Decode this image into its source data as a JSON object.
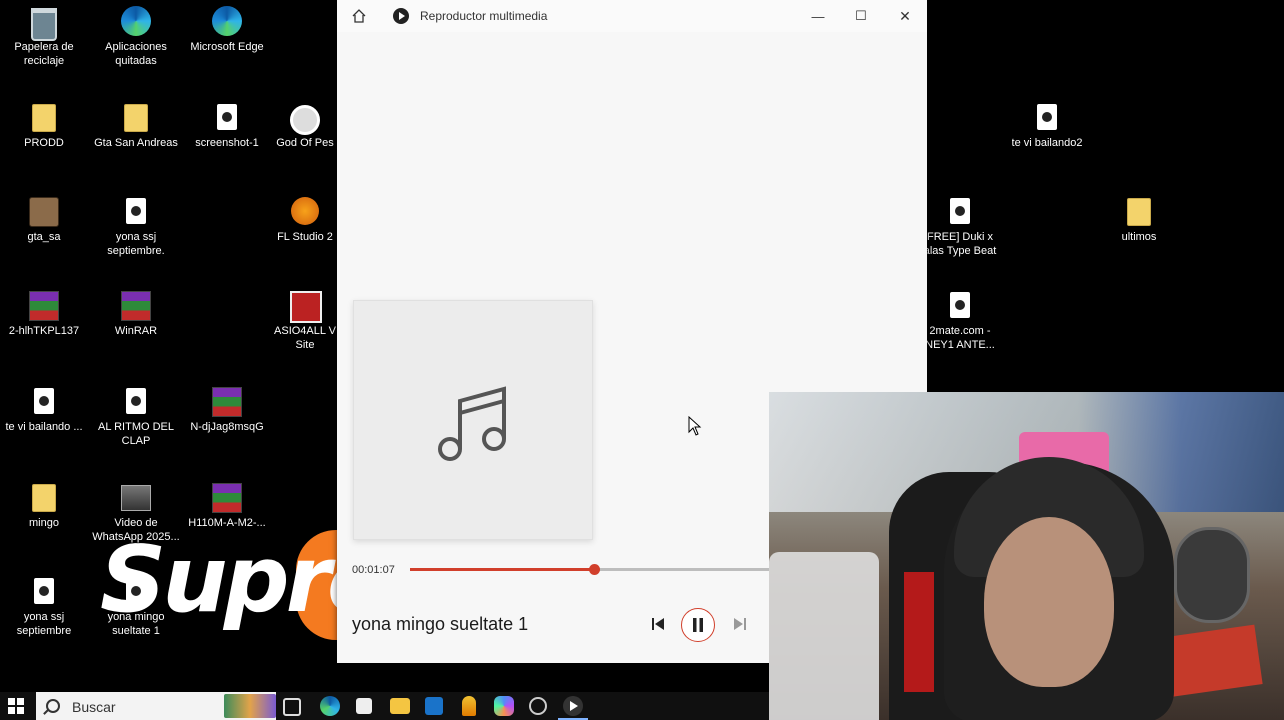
{
  "desktop": {
    "icons": [
      {
        "label": "Papelera de reciclaje",
        "icon": "recycle-bin-icon"
      },
      {
        "label": "Aplicaciones quitadas",
        "icon": "edge-icon"
      },
      {
        "label": "Microsoft Edge",
        "icon": "edge-icon"
      },
      {
        "label": "PRODD",
        "icon": "folder-icon"
      },
      {
        "label": "Gta San Andreas",
        "icon": "folder-icon"
      },
      {
        "label": "screenshot-1",
        "icon": "file-icon"
      },
      {
        "label": "God Of Pes",
        "icon": "disc-icon"
      },
      {
        "label": "te vi bailando2",
        "icon": "audio-file-icon"
      },
      {
        "label": "gta_sa",
        "icon": "game-icon"
      },
      {
        "label": "yona ssj septiembre.",
        "icon": "audio-file-icon"
      },
      {
        "label": "FL Studio 2",
        "icon": "fl-studio-icon"
      },
      {
        "label": "FREE] Duki x alas Type Beat",
        "icon": "audio-file-icon"
      },
      {
        "label": "ultimos",
        "icon": "folder-icon"
      },
      {
        "label": "2-hlhTKPL137",
        "icon": "rar-icon"
      },
      {
        "label": "WinRAR",
        "icon": "rar-icon"
      },
      {
        "label": "ASIO4ALL V Site",
        "icon": "asio-icon"
      },
      {
        "label": "2mate.com - NEY1 ANTE...",
        "icon": "audio-file-icon"
      },
      {
        "label": "te vi bailando ...",
        "icon": "audio-file-icon"
      },
      {
        "label": "AL RITMO DEL CLAP",
        "icon": "audio-file-icon"
      },
      {
        "label": "N-djJag8msqG",
        "icon": "rar-icon"
      },
      {
        "label": "mingo",
        "icon": "folder-icon"
      },
      {
        "label": "Video de WhatsApp 2025...",
        "icon": "video-file-icon"
      },
      {
        "label": "H110M-A-M2-...",
        "icon": "rar-icon"
      },
      {
        "label": "yona ssj septiembre",
        "icon": "audio-file-icon"
      },
      {
        "label": "yona mingo sueltate 1",
        "icon": "audio-file-icon"
      }
    ],
    "logo_text": "Supre"
  },
  "player": {
    "title": "Reproductor multimedia",
    "current_time": "00:01:07",
    "progress": 0.51,
    "song_title": "yona mingo sueltate 1",
    "accent": "#d13f2b",
    "buttons": {
      "minimize": "—",
      "maximize": "☐",
      "close": "✕"
    }
  },
  "taskbar": {
    "search_placeholder": "Buscar",
    "apps": [
      "task-view-icon",
      "edge-icon",
      "store-icon",
      "file-explorer-icon",
      "outlook-icon",
      "shield-app-icon",
      "copilot-icon",
      "clock-app-icon",
      "media-player-icon"
    ]
  }
}
